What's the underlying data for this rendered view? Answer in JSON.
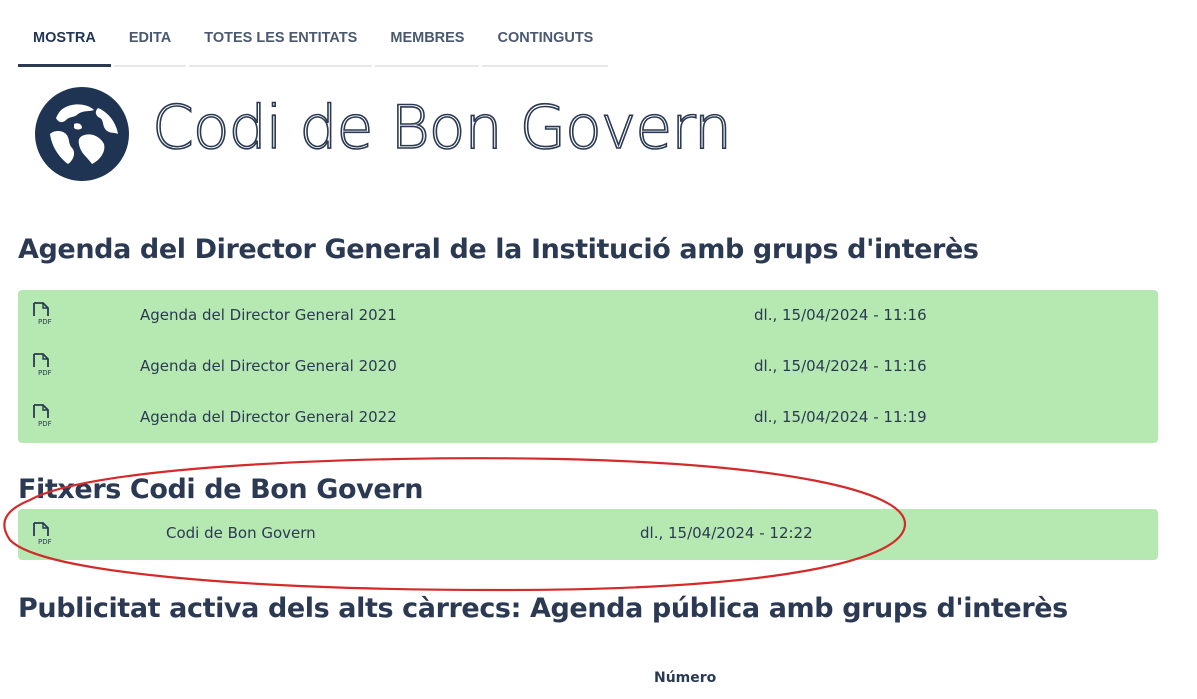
{
  "tabs": [
    {
      "label": "MOSTRA",
      "active": true
    },
    {
      "label": "EDITA",
      "active": false
    },
    {
      "label": "TOTES LES ENTITATS",
      "active": false
    },
    {
      "label": "MEMBRES",
      "active": false
    },
    {
      "label": "CONTINGUTS",
      "active": false
    }
  ],
  "site": {
    "title": "Codi de Bon Govern",
    "logo_icon": "globe-icon"
  },
  "sections": [
    {
      "title": "Agenda del Director General de la Institució amb grups d'interès",
      "files": [
        {
          "name": "Agenda del Director General 2021",
          "date": "dl., 15/04/2024 - 11:16",
          "icon": "pdf-icon"
        },
        {
          "name": "Agenda del Director General 2020",
          "date": "dl., 15/04/2024 - 11:16",
          "icon": "pdf-icon"
        },
        {
          "name": "Agenda del Director General 2022",
          "date": "dl., 15/04/2024 - 11:19",
          "icon": "pdf-icon"
        }
      ]
    },
    {
      "title": "Fitxers Codi de Bon Govern",
      "files": [
        {
          "name": "Codi de Bon Govern",
          "date": "dl., 15/04/2024 - 12:22",
          "icon": "pdf-icon"
        }
      ]
    },
    {
      "title": "Publicitat activa dels alts càrrecs: Agenda pública amb grups d'interès",
      "table": {
        "visible_header": "Número"
      }
    }
  ],
  "colors": {
    "text": "#2b3a52",
    "file_box": "#b5e9b1",
    "annotation": "#d42a2a"
  }
}
